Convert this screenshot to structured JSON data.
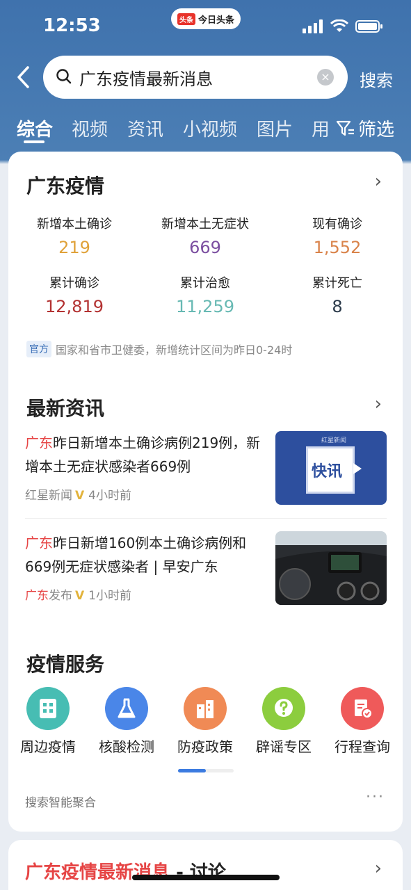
{
  "status_bar": {
    "time": "12:53",
    "app_badge_logo": "头条",
    "app_badge_name": "今日头条"
  },
  "search": {
    "query": "广东疫情最新消息",
    "clear_icon": "×",
    "button_label": "搜索"
  },
  "tabs": [
    "综合",
    "视频",
    "资讯",
    "小视频",
    "图片",
    "用"
  ],
  "filter_label": "筛选",
  "epidemic": {
    "title": "广东疫情",
    "stats": [
      {
        "label": "新增本土确诊",
        "value": "219",
        "color": "#e0a23a"
      },
      {
        "label": "新增本土无症状",
        "value": "669",
        "color": "#7b4ea0"
      },
      {
        "label": "现有确诊",
        "value": "1,552",
        "color": "#d9834a"
      },
      {
        "label": "累计确诊",
        "value": "12,819",
        "color": "#b33232"
      },
      {
        "label": "累计治愈",
        "value": "11,259",
        "color": "#67b9b3"
      },
      {
        "label": "累计死亡",
        "value": "8",
        "color": "#2b3a4a"
      }
    ],
    "official_tag": "官方",
    "official_note": "国家和省市卫健委，新增统计区间为昨日0-24时"
  },
  "latest_news": {
    "title": "最新资讯",
    "items": [
      {
        "highlight": "广东",
        "headline": "昨日新增本土确诊病例219例，新增本土无症状感染者669例",
        "source": "红星新闻",
        "verified": "V",
        "time": "4小时前",
        "thumb_text": "快讯",
        "thumb_brand": "红星新闻"
      },
      {
        "highlight": "广东",
        "headline": "昨日新增160例本土确诊病例和669例无症状感染者 | 早安广东",
        "source_highlight": "广东",
        "source": "发布",
        "verified": "V",
        "time": "1小时前"
      }
    ]
  },
  "services": {
    "title": "疫情服务",
    "items": [
      {
        "label": "周边疫情",
        "icon": "building-icon",
        "color": "#47bdb3"
      },
      {
        "label": "核酸检测",
        "icon": "flask-icon",
        "color": "#4a86e8"
      },
      {
        "label": "防疫政策",
        "icon": "city-icon",
        "color": "#f08a55"
      },
      {
        "label": "辟谣专区",
        "icon": "question-icon",
        "color": "#8ccd3e"
      },
      {
        "label": "行程查询",
        "icon": "document-check-icon",
        "color": "#ef5a5a"
      }
    ],
    "footer": "搜索智能聚合",
    "more": "···"
  },
  "discussion": {
    "highlight": "广东疫情最新消息",
    "suffix": " - 讨论"
  }
}
